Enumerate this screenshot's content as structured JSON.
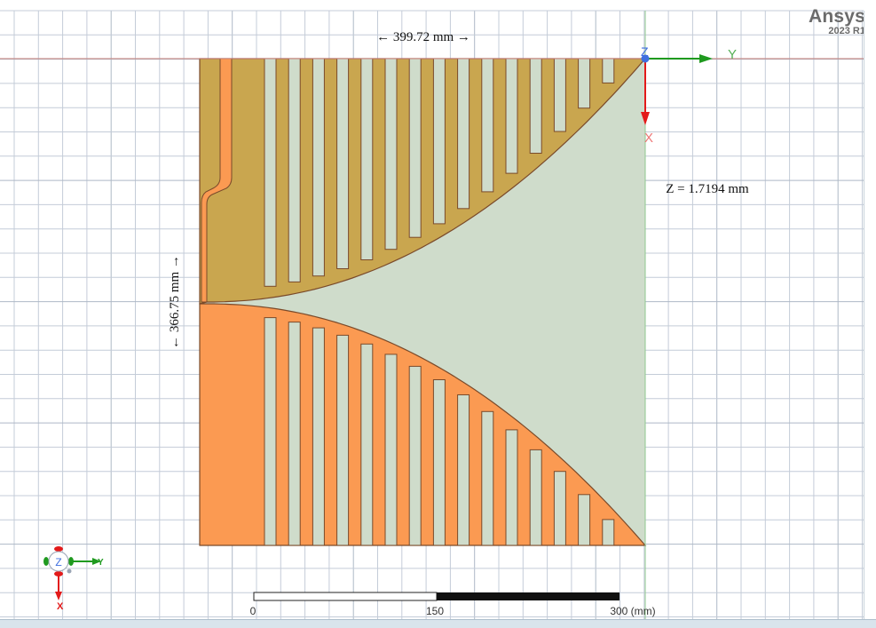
{
  "brand": {
    "name": "Ansys",
    "version": "2023 R1"
  },
  "dimensions": {
    "width_label": "← 399.72 mm →",
    "height_label": "← 366.75 mm →",
    "z_readout": "Z = 1.7194 mm"
  },
  "axes": {
    "z": "Z",
    "y": "Y",
    "x": "X"
  },
  "triad": {
    "z": "Z",
    "y": "Y",
    "x": "X"
  },
  "scale_bar": {
    "tick_0": "0",
    "tick_mid": "150",
    "tick_end": "300 (mm)"
  },
  "colors": {
    "upper_part": "#c9a64f",
    "lower_part": "#fb9a52",
    "outline": "#7a4a2a",
    "cavity": "#cfdccb",
    "grid": "#c4ccd8",
    "axis_y": "#1f9a1f",
    "axis_x": "#e31a1a",
    "origin": "#3f6fe0"
  }
}
